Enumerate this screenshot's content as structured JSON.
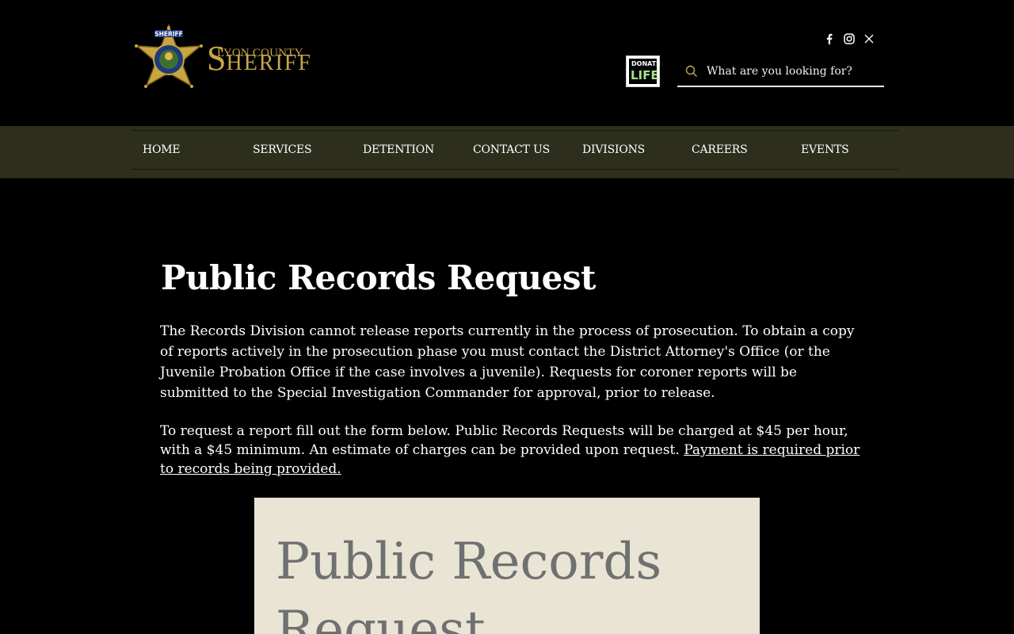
{
  "header": {
    "logo": {
      "line1": "LYON COUNTY",
      "line2_cap": "S",
      "line2_rest": "HERIFF",
      "badge_text": "SHERIFF"
    },
    "social": [
      "facebook-icon",
      "instagram-icon",
      "x-icon"
    ],
    "donate": {
      "line1": "DONATE",
      "line2": "LIFE"
    },
    "search": {
      "placeholder": "What are you looking for?"
    }
  },
  "nav": {
    "items": [
      {
        "label": "HOME"
      },
      {
        "label": "SERVICES"
      },
      {
        "label": "DETENTION"
      },
      {
        "label": "CONTACT US"
      },
      {
        "label": "DIVISIONS"
      },
      {
        "label": "CAREERS"
      },
      {
        "label": "EVENTS"
      }
    ]
  },
  "main": {
    "title": "Public Records Request",
    "paragraph1": "The Records Division cannot release reports currently in the process of prosecution. To obtain a copy of reports actively in the prosecution phase you must contact the District Attorney's Office (or the Juvenile Probation Office if the case involves a juvenile). Requests for coroner reports will be submitted to the Special Investigation Commander for approval, prior to release.",
    "paragraph2": "To request a report fill out the form below. Public Records Requests will be charged at $45 per hour, with a $45 minimum. An estimate of charges can be provided upon request. ",
    "paragraph2_link": "Payment is required prior to records being provided.",
    "form_title": "Public Records Request"
  },
  "colors": {
    "navbar": "#2d2f1c",
    "gold": "#c8a64a",
    "form_bg": "#e9e4d4",
    "form_title": "#6f7171"
  }
}
